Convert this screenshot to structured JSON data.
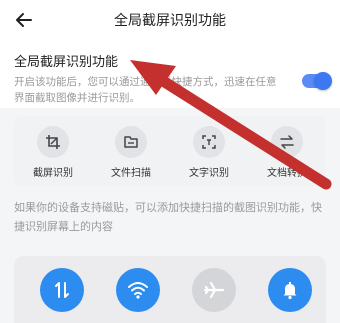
{
  "header": {
    "title": "全局截屏识别功能"
  },
  "setting": {
    "title": "全局截屏识别功能",
    "description": "开启该功能后，您可以通过通知栏快捷方式，迅速在任意界面截取图像并进行识别。",
    "enabled": true
  },
  "features": [
    {
      "label": "截屏识别",
      "icon": "crop-icon"
    },
    {
      "label": "文件扫描",
      "icon": "file-scan-icon"
    },
    {
      "label": "文字识别",
      "icon": "text-recognition-icon"
    },
    {
      "label": "文档转换",
      "icon": "convert-icon"
    }
  ],
  "tip": "如果你的设备支持磁贴，可以添加快捷扫描的截图识别功能，快捷识别屏幕上的内容",
  "quick_settings": [
    {
      "name": "mobile-data",
      "icon": "data-transfer-icon",
      "active": true
    },
    {
      "name": "wifi",
      "icon": "wifi-icon",
      "active": true
    },
    {
      "name": "airplane-mode",
      "icon": "airplane-icon",
      "active": false
    },
    {
      "name": "notifications",
      "icon": "bell-icon",
      "active": true
    }
  ],
  "colors": {
    "accent": "#3b78f2",
    "tile_active": "#2d8cf0",
    "tile_inactive": "#d4d5d8",
    "annotation_arrow": "#c3302e"
  }
}
